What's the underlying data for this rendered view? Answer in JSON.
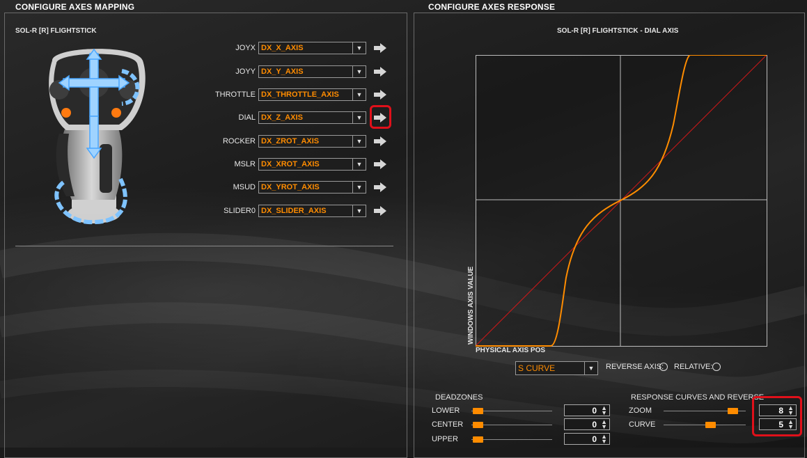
{
  "left_panel": {
    "title": "CONFIGURE AXES MAPPING",
    "device_name": "SOL-R [R] FLIGHTSTICK",
    "rows": [
      {
        "label": "JOYX",
        "value": "DX_X_AXIS"
      },
      {
        "label": "JOYY",
        "value": "DX_Y_AXIS"
      },
      {
        "label": "THROTTLE",
        "value": "DX_THROTTLE_AXIS"
      },
      {
        "label": "DIAL",
        "value": "DX_Z_AXIS"
      },
      {
        "label": "ROCKER",
        "value": "DX_ZROT_AXIS"
      },
      {
        "label": "MSLR",
        "value": "DX_XROT_AXIS"
      },
      {
        "label": "MSUD",
        "value": "DX_YROT_AXIS"
      },
      {
        "label": "SLIDER0",
        "value": "DX_SLIDER_AXIS"
      }
    ]
  },
  "right_panel": {
    "title": "CONFIGURE AXES RESPONSE",
    "graph_title": "SOL-R [R] FLIGHTSTICK - DIAL AXIS",
    "y_label": "WINDOWS AXIS VALUE",
    "x_label": "PHYSICAL AXIS POS",
    "curve_type": "S CURVE",
    "reverse_label": "REVERSE AXIS:",
    "relative_label": "RELATIVE:",
    "deadzones": {
      "title": "DEADZONES",
      "lower": {
        "label": "LOWER",
        "value": "0"
      },
      "center": {
        "label": "CENTER",
        "value": "0"
      },
      "upper": {
        "label": "UPPER",
        "value": "0"
      }
    },
    "response": {
      "title": "RESPONSE CURVES AND REVERSE",
      "zoom": {
        "label": "ZOOM",
        "value": "8"
      },
      "curve": {
        "label": "CURVE",
        "value": "5"
      }
    }
  },
  "colors": {
    "accent": "#ff8c00",
    "highlight": "#e0101a",
    "linear_line": "#d01818"
  }
}
